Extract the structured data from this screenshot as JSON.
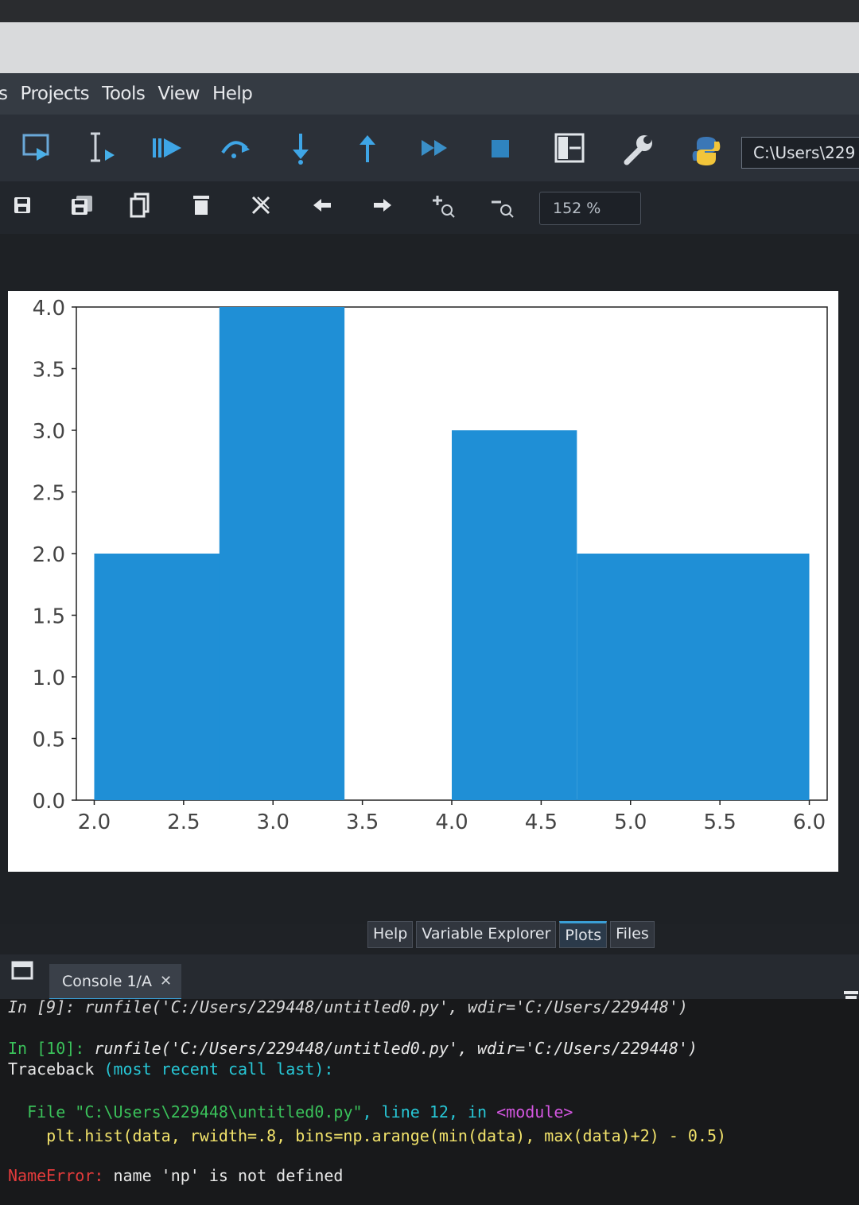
{
  "menu": [
    "s",
    "Projects",
    "Tools",
    "View",
    "Help"
  ],
  "toolbar": {
    "path": "C:\\Users\\229",
    "zoom": "152 %",
    "icons": [
      "run-cell-icon",
      "debug-cursor-icon",
      "continue-icon",
      "step-over-icon",
      "step-into-icon",
      "step-out-icon",
      "fast-forward-icon",
      "stop-icon",
      "layout-icon",
      "wrench-icon",
      "python-icon"
    ],
    "plot_icons": [
      "save-icon",
      "save-all-icon",
      "copy-icon",
      "delete-icon",
      "close-all-icon",
      "back-arrow-icon",
      "forward-arrow-icon",
      "zoom-in-icon",
      "zoom-out-icon"
    ]
  },
  "chart_data": {
    "type": "bar",
    "title": "",
    "xlabel": "",
    "ylabel": "",
    "xlim": [
      1.9,
      6.1
    ],
    "ylim": [
      0,
      4.0
    ],
    "bars": [
      {
        "x0": 2.0,
        "x1": 3.0,
        "value": 2
      },
      {
        "x0": 2.7,
        "x1": 3.4,
        "value": 4
      },
      {
        "x0": 4.0,
        "x1": 4.7,
        "value": 3
      },
      {
        "x0": 4.7,
        "x1": 6.0,
        "value": 2
      }
    ],
    "xticks": [
      "2.0",
      "2.5",
      "3.0",
      "3.5",
      "4.0",
      "4.5",
      "5.0",
      "5.5",
      "6.0"
    ],
    "yticks": [
      "0.0",
      "0.5",
      "1.0",
      "1.5",
      "2.0",
      "2.5",
      "3.0",
      "3.5",
      "4.0"
    ],
    "bar_color": "#1f8fd6",
    "grid": false
  },
  "pane_tabs": [
    "Help",
    "Variable Explorer",
    "Plots",
    "Files"
  ],
  "console": {
    "tab_label": "Console 1/A",
    "lines": {
      "l1": "In [9]: runfile('C:/Users/229448/untitled0.py', wdir='C:/Users/229448')",
      "l2_prompt": "In [10]:",
      "l2_code": " runfile('C:/Users/229448/untitled0.py', wdir='C:/Users/229448')",
      "l3_a": "Traceback ",
      "l3_b": "(most recent call last):",
      "l4_a": "  File ",
      "l4_b": "\"C:\\Users\\229448\\untitled0.py\"",
      "l4_c": ", line 12, in ",
      "l4_d": "<module>",
      "l5": "    plt.hist(data, rwidth=.8, bins=np.arange(min(data), max(data)+2) - 0.5)",
      "l6_a": "NameError:",
      "l6_b": " name 'np' is not defined"
    }
  },
  "colors": {
    "accent": "#3a9fd6",
    "prompt_green": "#3ac15a",
    "error_red": "#e33b3b"
  }
}
